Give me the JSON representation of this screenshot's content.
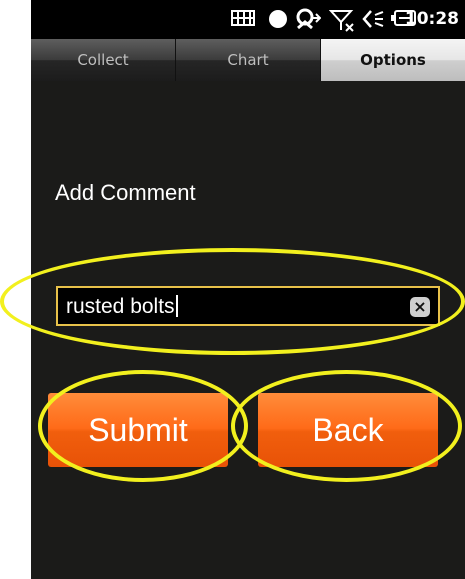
{
  "status_bar": {
    "time": "10:28",
    "icons": [
      "keyboard-icon",
      "record-icon",
      "sync-icon",
      "no-signal-icon",
      "speaker-icon",
      "battery-icon"
    ]
  },
  "tabs": [
    {
      "label": "Collect",
      "active": false
    },
    {
      "label": "Chart",
      "active": false
    },
    {
      "label": "Options",
      "active": true
    }
  ],
  "form": {
    "title": "Add Comment",
    "comment_value": "rusted bolts",
    "submit_label": "Submit",
    "back_label": "Back"
  },
  "colors": {
    "accent_orange": "#ff6a18",
    "annotation_yellow": "#f2f01e",
    "input_border": "#e8c24a",
    "background": "#1b1b19"
  }
}
